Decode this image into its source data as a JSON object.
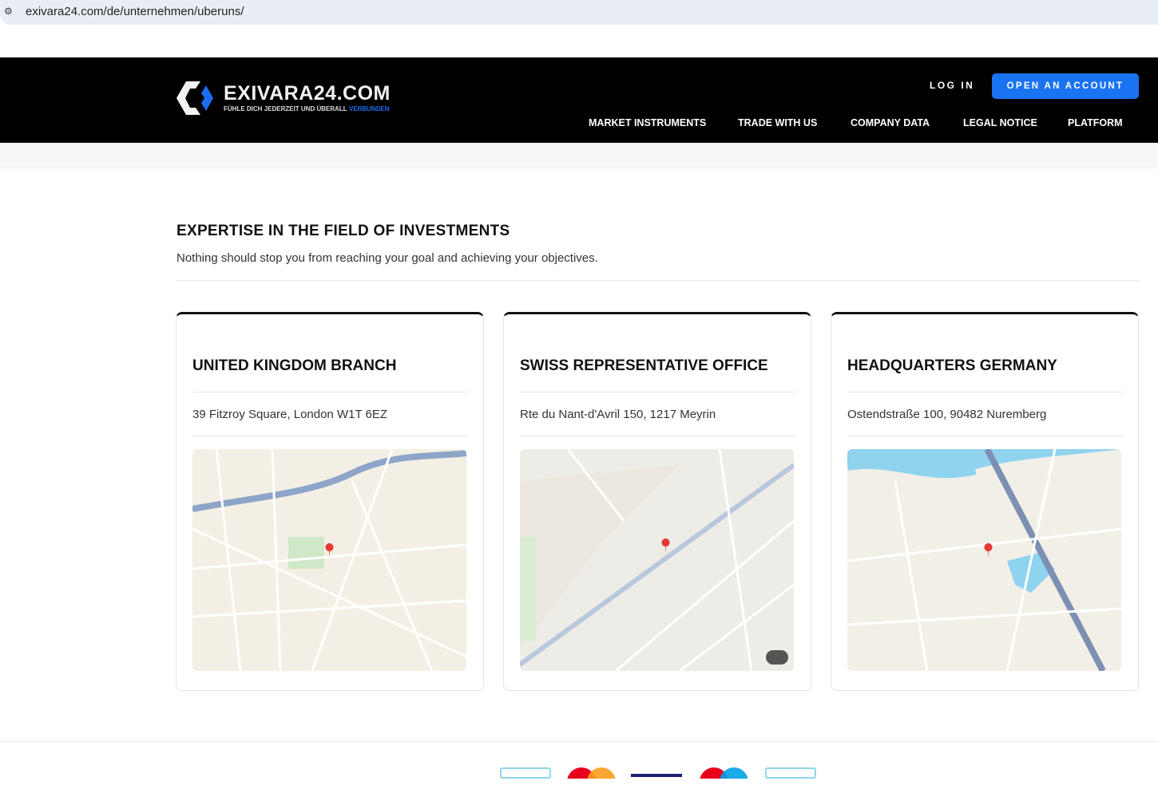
{
  "browser": {
    "url": "exivara24.com/de/unternehmen/uberuns/"
  },
  "header": {
    "logo_title": "EXIVARA24.COM",
    "logo_tagline": "FÜHLE DICH JEDERZEIT UND ÜBERALL",
    "logo_tagline_accent": "VERBUNDEN",
    "login": "LOG IN",
    "open_account": "OPEN AN ACCOUNT",
    "nav": [
      "MARKET INSTRUMENTS",
      "TRADE WITH US",
      "COMPANY DATA",
      "LEGAL NOTICE",
      "PLATFORM"
    ]
  },
  "main": {
    "title": "EXPERTISE IN THE FIELD OF INVESTMENTS",
    "subtitle": "Nothing should stop you from reaching your goal and achieving your objectives.",
    "offices": [
      {
        "title": "UNITED KINGDOM BRANCH",
        "address": "39 Fitzroy Square, London W1T 6EZ"
      },
      {
        "title": "SWISS REPRESENTATIVE OFFICE",
        "address": "Rte du Nant-d'Avril 150, 1217 Meyrin"
      },
      {
        "title": "HEADQUARTERS GERMANY",
        "address": "Ostendstraße 100, 90482 Nuremberg"
      }
    ]
  },
  "colors": {
    "accent": "#1a73f0",
    "header_bg": "#000000"
  }
}
